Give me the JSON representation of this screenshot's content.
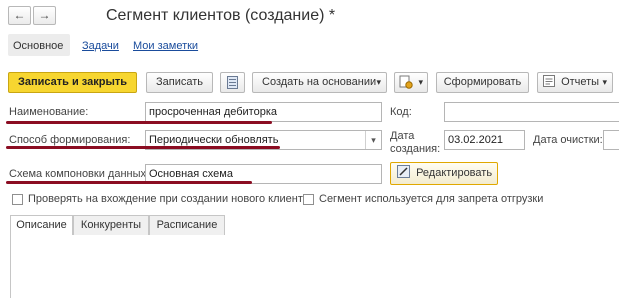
{
  "window": {
    "title": "Сегмент клиентов (создание) *"
  },
  "nav": {
    "back": "←",
    "forward": "→"
  },
  "section_tabs": {
    "main": "Основное",
    "tasks": "Задачи",
    "notes": "Мои заметки"
  },
  "toolbar": {
    "save_close": "Записать и закрыть",
    "save": "Записать",
    "create_based": "Создать на основании",
    "form": "Сформировать",
    "reports": "Отчеты",
    "dropdown_arrow": "▾"
  },
  "form": {
    "name_label": "Наименование:",
    "name_value": "просроченная дебиторка",
    "code_label": "Код:",
    "code_value": "",
    "method_label": "Способ формирования:",
    "method_value": "Периодически обновлять",
    "created_label_1": "Дата",
    "created_label_2": "создания:",
    "created_value": "03.02.2021",
    "clear_label": "Дата очистки:",
    "clear_value": "",
    "schema_label": "Схема компоновки данных:",
    "schema_value": "Основная схема",
    "edit_button": "Редактировать",
    "check1": "Проверять на вхождение при создании нового клиента",
    "check2": "Сегмент используется для запрета отгрузки"
  },
  "bottom_tabs": [
    "Описание",
    "Конкуренты",
    "Расписание"
  ],
  "colors": {
    "accent_yellow": "#f7d630",
    "underline_red": "#8b0d22",
    "link_blue": "#1a4c9c"
  }
}
